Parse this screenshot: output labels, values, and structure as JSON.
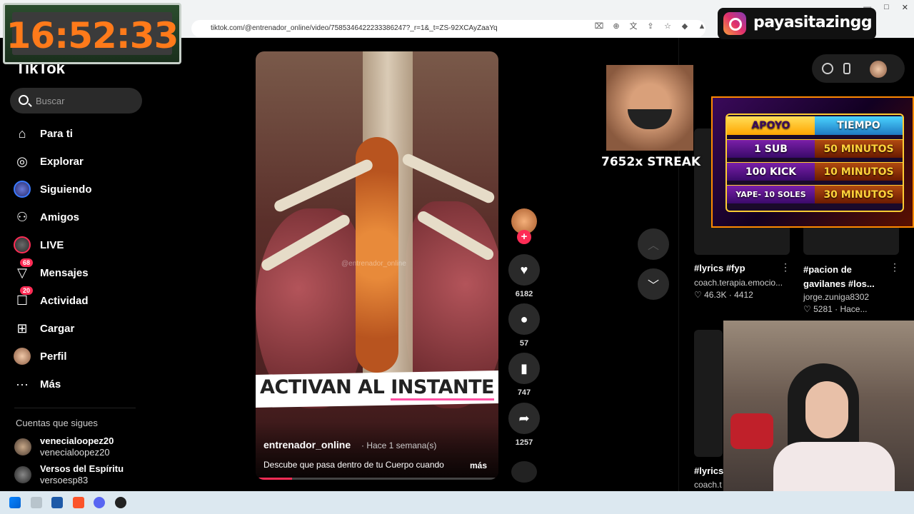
{
  "browser": {
    "url": "tiktok.com/@entrenador_online/video/7585346422233386247?_r=1&_t=ZS-92XCAyZaaYq"
  },
  "overlay_clock": {
    "time": "16:52:33"
  },
  "overlay_instagram": {
    "handle": "payasitazingg"
  },
  "overlay_streak": {
    "text": "7652x STREAK"
  },
  "overlay_apoyo": {
    "headers": [
      "APOYO",
      "TIEMPO"
    ],
    "rows": [
      {
        "apoyo": "1 SUB",
        "tiempo": "50 MINUTOS"
      },
      {
        "apoyo": "100 KICK",
        "tiempo": "10 MINUTOS"
      },
      {
        "apoyo": "YAPE- 10 SOLES",
        "tiempo": "30 MINUTOS"
      }
    ]
  },
  "sidebar": {
    "logo": "TikTok",
    "search_placeholder": "Buscar",
    "nav": [
      {
        "label": "Para ti",
        "icon": "home-icon"
      },
      {
        "label": "Explorar",
        "icon": "compass-icon"
      },
      {
        "label": "Siguiendo",
        "icon": "following-avatar-icon"
      },
      {
        "label": "Amigos",
        "icon": "friends-icon"
      },
      {
        "label": "LIVE",
        "icon": "live-avatar-icon"
      },
      {
        "label": "Mensajes",
        "icon": "messages-icon",
        "badge": "68"
      },
      {
        "label": "Actividad",
        "icon": "activity-icon",
        "badge": "20"
      },
      {
        "label": "Cargar",
        "icon": "upload-icon"
      },
      {
        "label": "Perfil",
        "icon": "profile-avatar-icon"
      },
      {
        "label": "Más",
        "icon": "more-icon"
      }
    ],
    "following_title": "Cuentas que sigues",
    "following": [
      {
        "name": "venecialoopez20",
        "handle": "venecialoopez20"
      },
      {
        "name": "Versos del Espíritu",
        "handle": "versoesp83"
      }
    ]
  },
  "video": {
    "caption_part1": "ACTIVAN AL",
    "caption_part2": "INSTANTE",
    "watermark": "@entrenador_online",
    "author": "entrenador_online",
    "date": "· Hace 1 semana(s)",
    "description": "Descube que pasa dentro de tu Cuerpo cuando",
    "more": "más",
    "progress": 0.15
  },
  "actions": {
    "likes": "6182",
    "comments": "57",
    "saves": "747",
    "shares": "1257"
  },
  "right_panel": {
    "cards": [
      {
        "title": "#lyrics #fyp",
        "author": "coach.terapia.emocio...",
        "likes": "46.3K",
        "time": "· 4412"
      },
      {
        "title": "#pacion de gavilanes #los...",
        "author": "jorge.zuniga8302",
        "likes": "5281",
        "time": "· Hace..."
      },
      {
        "title": "#lyrics",
        "author": "coach.t",
        "likes": "",
        "time": ""
      }
    ]
  },
  "colors": {
    "accent": "#fe2c55",
    "bg": "#000000"
  }
}
